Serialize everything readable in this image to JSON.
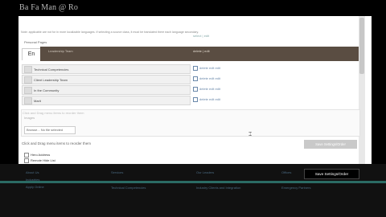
{
  "window": {
    "title": "Ba Fa Man @ Ro"
  },
  "description": "Note: applicable are not for in more localizable languages. If selecting a source class, it must be translated there each language secondary.",
  "lang_links": "select | edit",
  "section_label": "Personal Pages",
  "lang_tab": "En",
  "top_band": {
    "item": "Leadership Team",
    "actions": "delete | edit"
  },
  "rows": [
    {
      "label": "Technical Competencies",
      "actions": "delete  edit  edit"
    },
    {
      "label": "Client Leadership Team",
      "actions": "delete  edit  edit"
    },
    {
      "label": "In the Community",
      "actions": "delete  edit  edit"
    },
    {
      "label": "Marit",
      "actions": "delete  edit  edit"
    }
  ],
  "hint": {
    "title": "Click and Drag menu items to reorder them",
    "sub": "Images",
    "image_button": "Browse...  No file selected"
  },
  "drag_text": "Click and Drag menu items to reorder them",
  "save_top_label": "Save Settings/Order",
  "checkboxes": [
    {
      "label": "Hero Address"
    },
    {
      "label": "Remote Hide List"
    }
  ],
  "footer": {
    "col1": [
      "About Us",
      "Industries",
      "Apply Online"
    ],
    "col2": [
      "Services",
      "Technical Competencies"
    ],
    "col3": [
      "Our Leaders",
      "Industry Clients and Integration"
    ],
    "col4": [
      "Offices",
      "Emergency Partners"
    ]
  },
  "save_button_label": "Save Settings/Order"
}
